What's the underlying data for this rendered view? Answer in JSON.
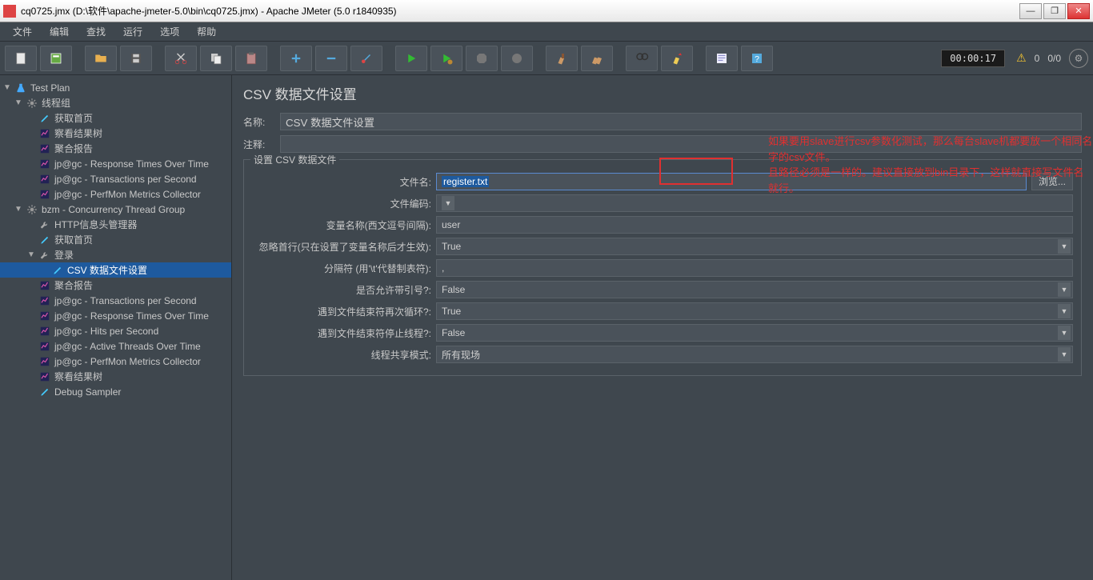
{
  "titlebar": "cq0725.jmx (D:\\软件\\apache-jmeter-5.0\\bin\\cq0725.jmx) - Apache JMeter (5.0 r1840935)",
  "menu": [
    "文件",
    "编辑",
    "查找",
    "运行",
    "选项",
    "帮助"
  ],
  "timer": "00:00:17",
  "warn_count": "0",
  "thread_count": "0/0",
  "tree": [
    {
      "ind": 0,
      "arrow": "▼",
      "icon": "flask",
      "label": "Test Plan"
    },
    {
      "ind": 1,
      "arrow": "▼",
      "icon": "gear",
      "label": "线程组"
    },
    {
      "ind": 2,
      "arrow": "",
      "icon": "pen",
      "label": "获取首页"
    },
    {
      "ind": 2,
      "arrow": "",
      "icon": "chart",
      "label": "察看结果树"
    },
    {
      "ind": 2,
      "arrow": "",
      "icon": "chart",
      "label": "聚合报告"
    },
    {
      "ind": 2,
      "arrow": "",
      "icon": "chart",
      "label": "jp@gc - Response Times Over Time"
    },
    {
      "ind": 2,
      "arrow": "",
      "icon": "chart",
      "label": "jp@gc - Transactions per Second"
    },
    {
      "ind": 2,
      "arrow": "",
      "icon": "chart",
      "label": "jp@gc - PerfMon Metrics Collector"
    },
    {
      "ind": 1,
      "arrow": "▼",
      "icon": "gear",
      "label": "bzm - Concurrency Thread Group"
    },
    {
      "ind": 2,
      "arrow": "",
      "icon": "wrench",
      "label": "HTTP信息头管理器"
    },
    {
      "ind": 2,
      "arrow": "",
      "icon": "pen",
      "label": "获取首页"
    },
    {
      "ind": 2,
      "arrow": "▼",
      "icon": "wrench",
      "label": "登录"
    },
    {
      "ind": 3,
      "arrow": "",
      "icon": "csv",
      "label": "CSV 数据文件设置",
      "selected": true
    },
    {
      "ind": 2,
      "arrow": "",
      "icon": "chart",
      "label": "聚合报告"
    },
    {
      "ind": 2,
      "arrow": "",
      "icon": "chart",
      "label": "jp@gc - Transactions per Second"
    },
    {
      "ind": 2,
      "arrow": "",
      "icon": "chart",
      "label": "jp@gc - Response Times Over Time"
    },
    {
      "ind": 2,
      "arrow": "",
      "icon": "chart",
      "label": "jp@gc - Hits per Second"
    },
    {
      "ind": 2,
      "arrow": "",
      "icon": "chart",
      "label": "jp@gc - Active Threads Over Time"
    },
    {
      "ind": 2,
      "arrow": "",
      "icon": "chart",
      "label": "jp@gc - PerfMon Metrics Collector"
    },
    {
      "ind": 2,
      "arrow": "",
      "icon": "chart",
      "label": "察看结果树"
    },
    {
      "ind": 2,
      "arrow": "",
      "icon": "pen",
      "label": "Debug Sampler"
    }
  ],
  "panel": {
    "title": "CSV 数据文件设置",
    "name_lbl": "名称:",
    "name_val": "CSV 数据文件设置",
    "comment_lbl": "注释:",
    "comment_val": "",
    "fieldset_lbl": "设置 CSV 数据文件",
    "rows": [
      {
        "lbl": "文件名:",
        "val": "register.txt",
        "type": "text",
        "highlight": true,
        "browse": true
      },
      {
        "lbl": "文件编码:",
        "val": "",
        "type": "select"
      },
      {
        "lbl": "变量名称(西文逗号间隔):",
        "val": "user",
        "type": "text"
      },
      {
        "lbl": "忽略首行(只在设置了变量名称后才生效):",
        "val": "True",
        "type": "select"
      },
      {
        "lbl": "分隔符 (用'\\t'代替制表符):",
        "val": ",",
        "type": "text"
      },
      {
        "lbl": "是否允许带引号?:",
        "val": "False",
        "type": "select"
      },
      {
        "lbl": "遇到文件结束符再次循环?:",
        "val": "True",
        "type": "select"
      },
      {
        "lbl": "遇到文件结束符停止线程?:",
        "val": "False",
        "type": "select"
      },
      {
        "lbl": "线程共享模式:",
        "val": "所有现场",
        "type": "select"
      }
    ],
    "browse_btn": "浏览...",
    "annotation_line1": "如果要用slave进行csv参数化测试，那么每台slave机都要放一个相同名字的csv文件。",
    "annotation_line2": "且路径必须是一样的。建议直接放到bin目录下，这样就直接写文件名就行。"
  }
}
